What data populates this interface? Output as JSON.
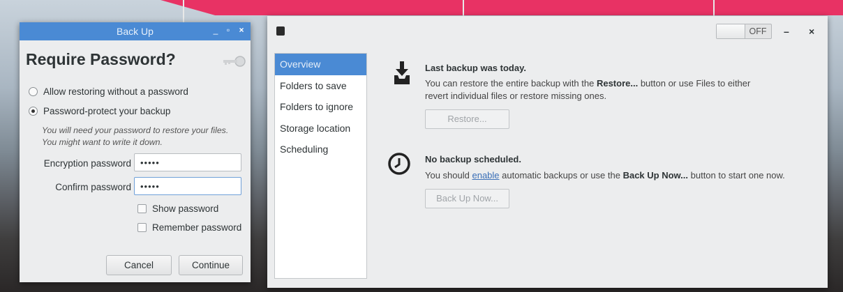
{
  "backup_dialog": {
    "title": "Back Up",
    "controls": {
      "minimize": "_",
      "maximize": "▫",
      "close": "×"
    },
    "heading": "Require Password?",
    "options": [
      {
        "label": "Allow restoring without a password",
        "selected": false
      },
      {
        "label": "Password-protect your backup",
        "selected": true
      }
    ],
    "hint_line1": "You will need your password to restore your files.",
    "hint_line2": "You might want to write it down.",
    "encryption_label": "Encryption password",
    "encryption_value": "•••••",
    "confirm_label": "Confirm password",
    "confirm_value": "•••••",
    "show_password_label": "Show password",
    "remember_password_label": "Remember password",
    "cancel_label": "Cancel",
    "continue_label": "Continue"
  },
  "main_window": {
    "toggle_label": "OFF",
    "controls": {
      "minimize": "–",
      "close": "×"
    },
    "sidebar": [
      {
        "label": "Overview",
        "selected": true
      },
      {
        "label": "Folders to save",
        "selected": false
      },
      {
        "label": "Folders to ignore",
        "selected": false
      },
      {
        "label": "Storage location",
        "selected": false
      },
      {
        "label": "Scheduling",
        "selected": false
      }
    ],
    "last_backup": {
      "title": "Last backup was today.",
      "text_before": "You can restore the entire backup with the ",
      "text_bold": "Restore...",
      "text_after": " button or use Files to either",
      "text_line2": "revert individual files or restore missing ones.",
      "button": "Restore..."
    },
    "schedule": {
      "title": "No backup scheduled.",
      "text_before": "You should ",
      "link": "enable",
      "text_middle": " automatic backups or use the ",
      "text_bold": "Back Up Now...",
      "text_after": " button to start one now.",
      "button": "Back Up Now..."
    }
  },
  "colors": {
    "accent": "#4a8ad4",
    "banner": "#e83264",
    "callout": "#e8e8e8"
  }
}
